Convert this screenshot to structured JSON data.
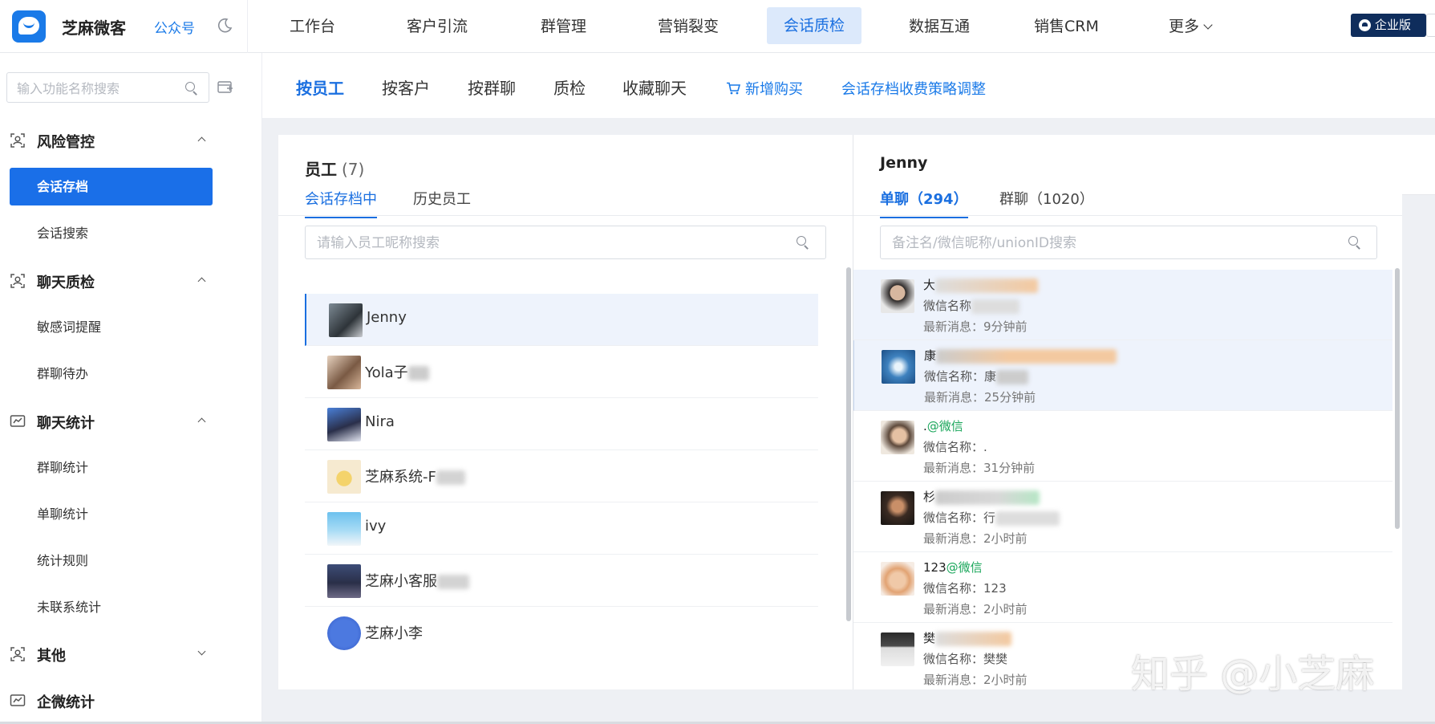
{
  "topbar": {
    "brand": "芝麻微客",
    "gzh_link": "公众号",
    "nav": [
      "工作台",
      "客户引流",
      "群管理",
      "营销裂变",
      "会话质检",
      "数据互通",
      "销售CRM",
      "更多"
    ],
    "active_nav": "会话质检",
    "enterprise_badge": "企业版"
  },
  "sidebar": {
    "search_placeholder": "输入功能名称搜索",
    "groups": [
      {
        "label": "风险管控",
        "icon": "person-scan-icon",
        "expanded": true,
        "items": [
          "会话存档",
          "会话搜索"
        ]
      },
      {
        "label": "聊天质检",
        "icon": "person-scan-icon",
        "expanded": true,
        "items": [
          "敏感词提醒",
          "群聊待办"
        ]
      },
      {
        "label": "聊天统计",
        "icon": "chart-card-icon",
        "expanded": true,
        "items": [
          "群聊统计",
          "单聊统计",
          "统计规则",
          "未联系统计"
        ]
      },
      {
        "label": "其他",
        "icon": "person-scan-icon",
        "expanded": false,
        "items": []
      },
      {
        "label": "企微统计",
        "icon": "chart-card-icon",
        "expanded": false,
        "items": []
      }
    ],
    "active_item": "会话存档"
  },
  "subnav": {
    "tabs": [
      "按员工",
      "按客户",
      "按群聊",
      "质检",
      "收藏聊天"
    ],
    "active_tab": "按员工",
    "links": [
      "新增购买",
      "会话存档收费策略调整"
    ]
  },
  "employee_panel": {
    "title": "员工",
    "count": "(7)",
    "tabs": [
      "会话存档中",
      "历史员工"
    ],
    "active_tab": "会话存档中",
    "search_placeholder": "请输入员工昵称搜索",
    "employees": [
      {
        "name": "Jenny",
        "selected": true
      },
      {
        "name": "Yola子",
        "selected": false
      },
      {
        "name": "Nira",
        "selected": false
      },
      {
        "name": "芝麻系统-F",
        "selected": false
      },
      {
        "name": "ivy",
        "selected": false
      },
      {
        "name": "芝麻小客服",
        "selected": false
      },
      {
        "name": "芝麻小李",
        "selected": false
      }
    ]
  },
  "chat_panel": {
    "employee_name": "Jenny",
    "tabs": [
      "单聊（294）",
      "群聊（1020）"
    ],
    "active_tab": "单聊（294）",
    "search_placeholder": "备注名/微信昵称/unionID搜索",
    "contacts": [
      {
        "name": "大",
        "tag": "",
        "wx_label": "微信名称",
        "wx_name": "",
        "msg_label": "最新消息：",
        "last": "9分钟前",
        "selected": true
      },
      {
        "name": "康",
        "tag": "",
        "wx_label": "微信名称：",
        "wx_name": "康",
        "msg_label": "最新消息：",
        "last": "25分钟前",
        "selected": true
      },
      {
        "name": ".",
        "tag": "@微信",
        "wx_label": "微信名称：",
        "wx_name": ".",
        "msg_label": "最新消息：",
        "last": "31分钟前",
        "selected": false
      },
      {
        "name": "杉",
        "tag": "",
        "wx_label": "微信名称：",
        "wx_name": "行",
        "msg_label": "最新消息：",
        "last": "2小时前",
        "selected": false
      },
      {
        "name": "123",
        "tag": "@微信",
        "wx_label": "微信名称：",
        "wx_name": "123",
        "msg_label": "最新消息：",
        "last": "2小时前",
        "selected": false
      },
      {
        "name": "樊",
        "tag": "",
        "wx_label": "微信名称：",
        "wx_name": "樊樊",
        "msg_label": "最新消息：",
        "last": "2小时前",
        "selected": false
      }
    ]
  },
  "watermark": "知乎 @小芝麻",
  "colors": {
    "accent": "#1a6fe0",
    "active_sidebar": "#1a6fe8",
    "wechat_tag": "#19a65a",
    "enterprise_badge": "#0f2d5c"
  }
}
